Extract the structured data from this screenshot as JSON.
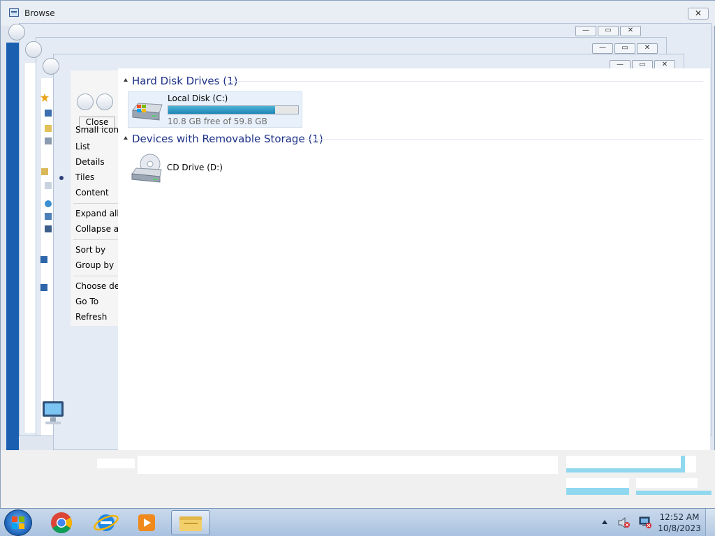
{
  "dialog": {
    "title": "Browse",
    "close_glyph": "✕"
  },
  "caption_buttons": {
    "minimize": "—",
    "maximize": "▭",
    "close": "✕"
  },
  "context_menu": {
    "close_label": "Close",
    "items": [
      {
        "label": "Small icons"
      },
      {
        "label": "List"
      },
      {
        "label": "Details"
      },
      {
        "label": "Tiles",
        "selected": true
      },
      {
        "label": "Content"
      },
      {
        "label": "Expand all groups"
      },
      {
        "label": "Collapse all groups"
      },
      {
        "label": "Sort by"
      },
      {
        "label": "Group by"
      },
      {
        "label": "Choose details..."
      },
      {
        "label": "Go To"
      },
      {
        "label": "Refresh"
      }
    ]
  },
  "content": {
    "groups": [
      {
        "title": "Hard Disk Drives (1)",
        "items": [
          {
            "name": "Local Disk (C:)",
            "free_text": "10.8 GB free of 59.8 GB",
            "used_fraction": 0.82,
            "icon": "hard-disk-icon"
          }
        ]
      },
      {
        "title": "Devices with Removable Storage (1)",
        "items": [
          {
            "name": "CD Drive (D:)",
            "icon": "cd-drive-icon"
          }
        ]
      }
    ]
  },
  "taskbar": {
    "apps": [
      {
        "name": "start",
        "icon": "windows-start-icon"
      },
      {
        "name": "chrome",
        "icon": "chrome-icon"
      },
      {
        "name": "internet-explorer",
        "icon": "internet-explorer-icon"
      },
      {
        "name": "media-player",
        "icon": "media-player-icon"
      },
      {
        "name": "windows-explorer",
        "icon": "folder-icon",
        "active": true
      }
    ],
    "tray": {
      "icons": [
        "show-hidden-icons-arrow",
        "volume-muted-icon",
        "network-disconnected-icon"
      ],
      "time": "12:52 AM",
      "date": "10/8/2023"
    }
  },
  "colors": {
    "group_header": "#1e3287",
    "tile_selected": "#e8f1fb",
    "progress_fill": "#1d86b3",
    "desktop": "#2a6fc0"
  }
}
